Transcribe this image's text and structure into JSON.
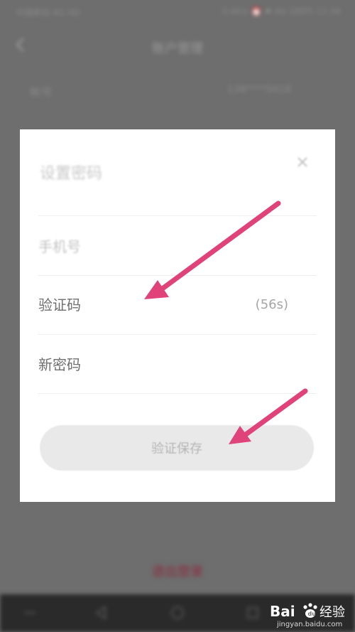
{
  "background": {
    "status_left": "中国移动 4G HD",
    "status_right": "0.4K/s ⏰ ✱ 4G 100% 11:34",
    "header_title": "账户管理",
    "account_label": "帐号",
    "account_value": "138****5618",
    "logout_label": "退出登录"
  },
  "modal": {
    "title": "设置密码",
    "phone_placeholder": "手机号",
    "code_placeholder": "验证码",
    "countdown": "(56s)",
    "password_placeholder": "新密码",
    "submit_label": "验证保存"
  },
  "watermark": {
    "logo_text": "Bai",
    "logo_text_suffix": "经验",
    "url": "jingyan.baidu.com"
  },
  "colors": {
    "arrow": "#e0427a",
    "overlay": "#6e6e6e",
    "modal": "#ffffff"
  }
}
